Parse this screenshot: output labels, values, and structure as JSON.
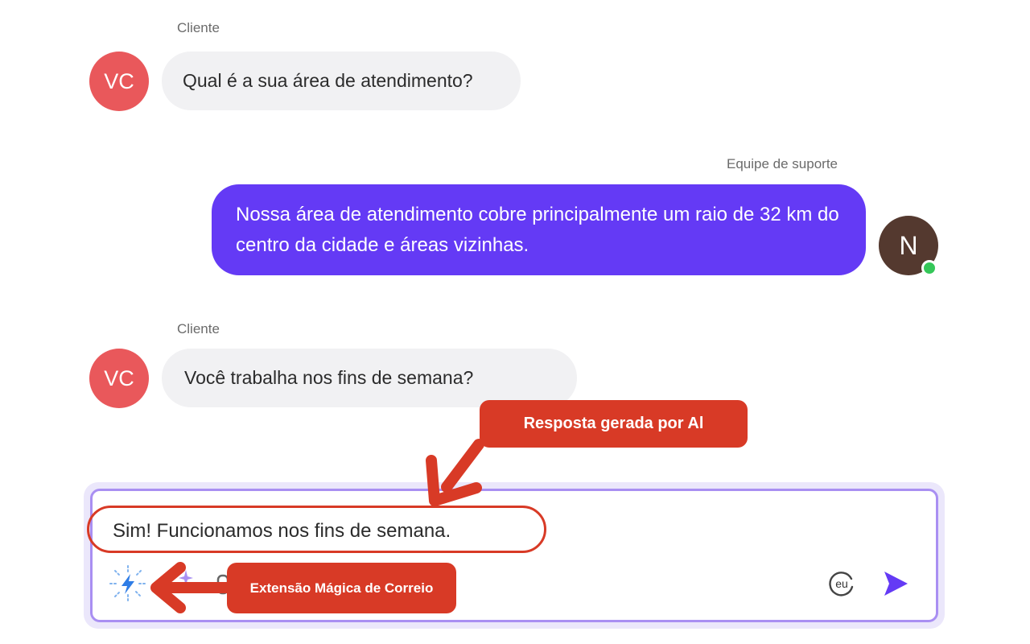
{
  "messages": [
    {
      "sender": "Cliente",
      "avatar_initials": "VC",
      "text": "Qual é a sua área de atendimento?"
    },
    {
      "sender": "Equipe de suporte",
      "avatar_initials": "N",
      "text": "Nossa área de atendimento cobre principalmente um raio de 32 km do centro da cidade e áreas vizinhas."
    },
    {
      "sender": "Cliente",
      "avatar_initials": "VC",
      "text": "Você trabalha nos fins de semana?"
    }
  ],
  "composer": {
    "draft_text": "Sim! Funcionamos nos fins de semana.",
    "language_badge": "eu",
    "icons": [
      "magic-lightning-icon",
      "send-icon"
    ]
  },
  "annotations": {
    "ai_response_label": "Resposta gerada por Al",
    "extension_label": "Extensão Mágica de Correio"
  },
  "colors": {
    "support_bubble": "#643af5",
    "client_bubble": "#f1f1f3",
    "client_avatar": "#e9585b",
    "support_avatar": "#54392f",
    "online_status": "#35c759",
    "composer_border": "#a98ff2",
    "annotation_red": "#d83a26",
    "send_icon": "#643af5"
  }
}
